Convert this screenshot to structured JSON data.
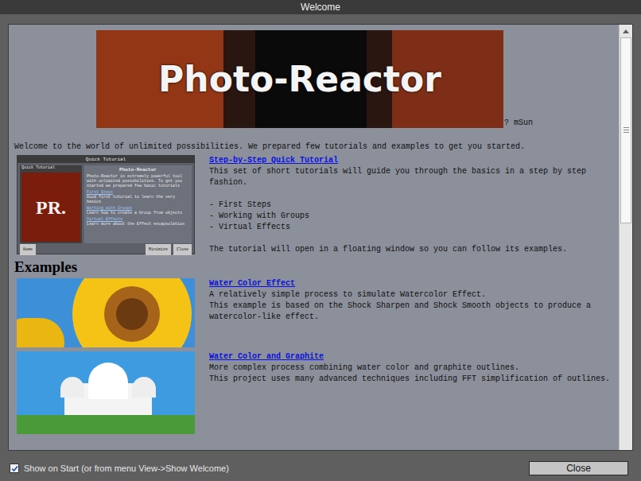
{
  "window": {
    "title": "Welcome"
  },
  "banner": {
    "title": "Photo-Reactor",
    "credit": "? mSun"
  },
  "intro": "Welcome to the world of unlimited possibilities. We prepared few tutorials and examples to get you started.",
  "tutorial": {
    "link": "Step-by-Step Quick Tutorial",
    "description": "This set of short tutorials will guide you through the basics in a step by step fashion.",
    "items": [
      "- First Steps",
      "- Working with Groups",
      "- Virtual Effects"
    ],
    "note": "The tutorial will open in a floating window so you can follow its examples.",
    "thumbnail": {
      "title": "Quick Tutorial",
      "sidebar": "Quick Tutorial",
      "logo": "PR.",
      "heading": "Photo-Reactor",
      "text": "Photo-Reactor is extremely powerful tool with unlimited possibilities. To get you started we prepared few basic tutorials",
      "links": [
        {
          "label": "First Steps",
          "hint": "Good first tutorial to learn the very basics"
        },
        {
          "label": "Working with Groups",
          "hint": "Learn how to create a Group from objects"
        },
        {
          "label": "Virtual Effects",
          "hint": "Learn more about the Effect encapsulation"
        }
      ],
      "buttons": [
        "Home",
        "Minimize",
        "Close"
      ]
    }
  },
  "examples_heading": "Examples",
  "examples": [
    {
      "kind": "sunflower",
      "title": "Water Color Effect",
      "lines": [
        "A relatively simple process to simulate Watercolor Effect.",
        "This example is based on the Shock Sharpen and Shock Smooth objects to produce a watercolor-like effect."
      ]
    },
    {
      "kind": "basilica",
      "title": "Water Color and Graphite",
      "lines": [
        "More complex process combining water color and graphite outlines.",
        "This project uses many advanced techniques including FFT simplification of outlines."
      ]
    }
  ],
  "scrollbar": {
    "level": 0.45
  },
  "footer": {
    "checkbox": {
      "label": "Show on Start (or from menu View->Show Welcome)",
      "checked": true
    },
    "button": "Close"
  }
}
